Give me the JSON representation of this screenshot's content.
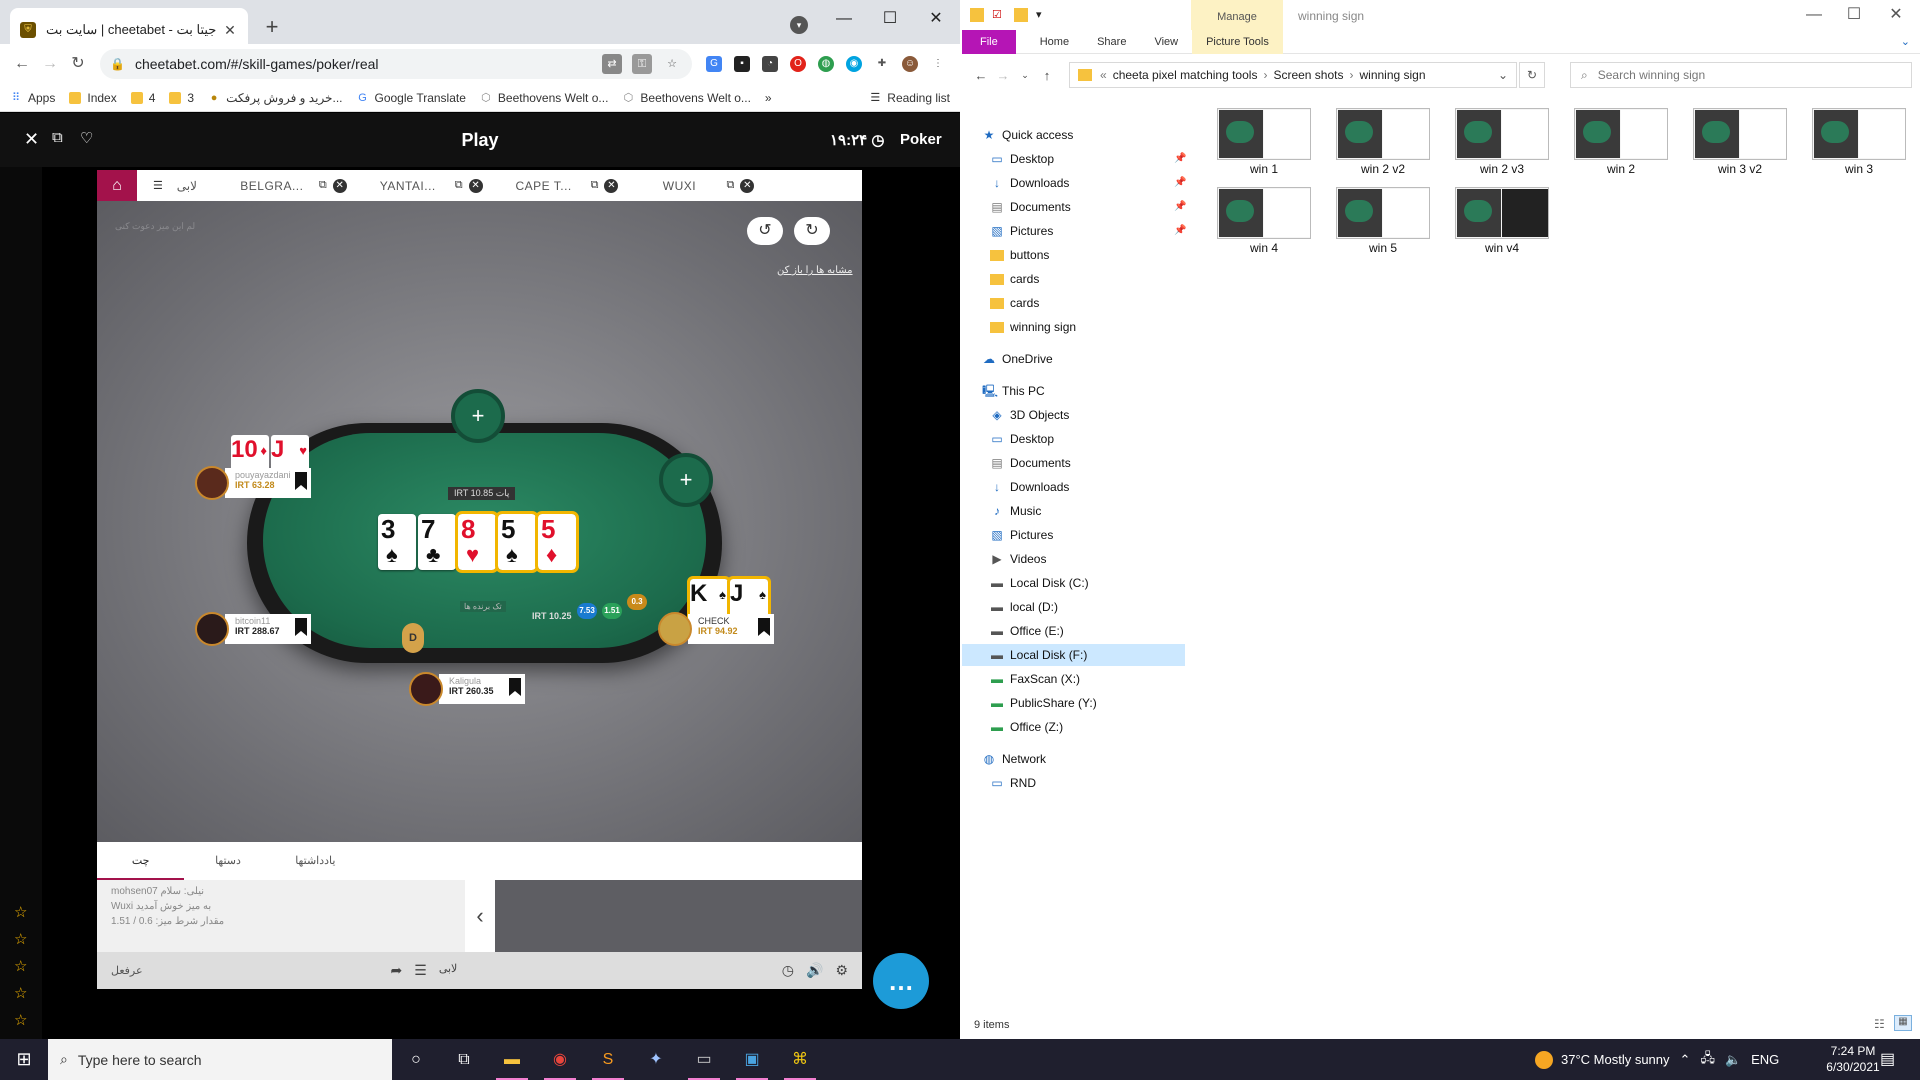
{
  "browser": {
    "tab_title": "سایت بت | cheetabet - جیتا بت",
    "url": "cheetabet.com/#/skill-games/poker/real",
    "bookmarks": [
      {
        "label": "Apps",
        "type": "apps"
      },
      {
        "label": "Index",
        "type": "folder"
      },
      {
        "label": "4",
        "type": "folder"
      },
      {
        "label": "3",
        "type": "folder"
      },
      {
        "label": "خرید و فروش پرفکت...",
        "type": "site"
      },
      {
        "label": "Google Translate",
        "type": "site"
      },
      {
        "label": "Beethovens Welt o...",
        "type": "site"
      },
      {
        "label": "Beethovens Welt o...",
        "type": "site"
      }
    ],
    "reading_list": "Reading list",
    "more": "»"
  },
  "poker": {
    "header_title": "Play",
    "clock": "۱۹:۲۴",
    "section": "Poker",
    "lobby": "لابی",
    "tabs": [
      "BELGRA...",
      "YANTAI...",
      "CAPE T...",
      "WUXI"
    ],
    "rearrange": "مشابه ها را باز کن",
    "faint_top": "لم این میز دعوت کنی",
    "pot": "IRT 10.85 پات",
    "board": [
      {
        "rank": "3",
        "suit": "♠",
        "color": "blk",
        "highlight": false
      },
      {
        "rank": "7",
        "suit": "♣",
        "color": "blk",
        "highlight": false
      },
      {
        "rank": "8",
        "suit": "♥",
        "color": "red",
        "highlight": true
      },
      {
        "rank": "5",
        "suit": "♠",
        "color": "blk",
        "highlight": true
      },
      {
        "rank": "5",
        "suit": "♦",
        "color": "red",
        "highlight": true
      }
    ],
    "players": {
      "p1": {
        "name": "pouyayazdani",
        "money": "IRT 63.28",
        "c1": "10",
        "s1": "♦",
        "c2": "J",
        "s2": "♥"
      },
      "p2": {
        "name": "bitcoin11",
        "money": "IRT 288.67"
      },
      "p3": {
        "name": "Kaligula",
        "money": "IRT 260.35"
      },
      "p4": {
        "name": "CHECK",
        "money": "IRT 94.92",
        "c1": "K",
        "s1": "♠",
        "c2": "J",
        "s2": "♠"
      }
    },
    "dealer": "D",
    "bet": "IRT 10.25",
    "chips": [
      "7.53",
      "1.51",
      "0.3"
    ],
    "table_tag": "تک برنده ها",
    "chat_tabs": [
      "چت",
      "دستها",
      "یادداشتها"
    ],
    "chat_lines": [
      "mohsen07 نیلی: سلام",
      "Wuxi به میز خوش آمدید",
      "مقدار شرط میز: 0.6 / 1.51"
    ],
    "chat_input": "عرفعل",
    "chat_lobby": "لابی"
  },
  "explorer": {
    "manage": "Manage",
    "title": "winning sign",
    "ribbon": [
      "File",
      "Home",
      "Share",
      "View",
      "Picture Tools"
    ],
    "path": [
      "cheeta pixel matching tools",
      "Screen shots",
      "winning sign"
    ],
    "search_placeholder": "Search winning sign",
    "nav": [
      {
        "label": "Quick access",
        "icon": "star-icon",
        "indent": 0
      },
      {
        "label": "Desktop",
        "icon": "desktop-icon",
        "indent": 1,
        "pin": true
      },
      {
        "label": "Downloads",
        "icon": "download-icon",
        "indent": 1,
        "pin": true
      },
      {
        "label": "Documents",
        "icon": "document-icon",
        "indent": 1,
        "pin": true
      },
      {
        "label": "Pictures",
        "icon": "pictures-icon",
        "indent": 1,
        "pin": true
      },
      {
        "label": "buttons",
        "icon": "folder-icon",
        "indent": 1
      },
      {
        "label": "cards",
        "icon": "folder-icon",
        "indent": 1
      },
      {
        "label": "cards",
        "icon": "folder-icon",
        "indent": 1
      },
      {
        "label": "winning sign",
        "icon": "folder-icon",
        "indent": 1
      },
      {
        "label": "OneDrive",
        "icon": "cloud-icon",
        "indent": 0
      },
      {
        "label": "This PC",
        "icon": "pc-icon",
        "indent": 0
      },
      {
        "label": "3D Objects",
        "icon": "cube-icon",
        "indent": 1
      },
      {
        "label": "Desktop",
        "icon": "desktop-icon",
        "indent": 1
      },
      {
        "label": "Documents",
        "icon": "document-icon",
        "indent": 1
      },
      {
        "label": "Downloads",
        "icon": "download-icon",
        "indent": 1
      },
      {
        "label": "Music",
        "icon": "music-icon",
        "indent": 1
      },
      {
        "label": "Pictures",
        "icon": "pictures-icon",
        "indent": 1
      },
      {
        "label": "Videos",
        "icon": "video-icon",
        "indent": 1
      },
      {
        "label": "Local Disk (C:)",
        "icon": "drive-icon",
        "indent": 1
      },
      {
        "label": "local (D:)",
        "icon": "drive-icon",
        "indent": 1
      },
      {
        "label": "Office (E:)",
        "icon": "drive-icon",
        "indent": 1
      },
      {
        "label": "Local Disk (F:)",
        "icon": "drive-icon",
        "indent": 1,
        "selected": true
      },
      {
        "label": "FaxScan (X:)",
        "icon": "network-drive-icon",
        "indent": 1
      },
      {
        "label": "PublicShare (Y:)",
        "icon": "network-drive-icon",
        "indent": 1
      },
      {
        "label": "Office (Z:)",
        "icon": "network-drive-icon",
        "indent": 1
      },
      {
        "label": "Network",
        "icon": "network-icon",
        "indent": 0
      },
      {
        "label": "RND",
        "icon": "computer-icon",
        "indent": 1
      }
    ],
    "files": [
      "win 1",
      "win 2 v2",
      "win 2 v3",
      "win 2",
      "win 3 v2",
      "win 3",
      "win 4",
      "win 5",
      "win v4"
    ],
    "status": "9 items"
  },
  "taskbar": {
    "search_placeholder": "Type here to search",
    "weather": "37°C  Mostly sunny",
    "lang": "ENG",
    "time": "7:24 PM",
    "date": "6/30/2021"
  }
}
